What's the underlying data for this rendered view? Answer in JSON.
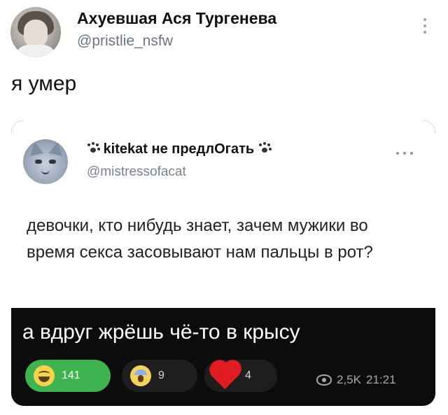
{
  "top_tweet": {
    "author_name": "Ахуевшая Ася Тургенева",
    "author_handle": "@pristlie_nsfw",
    "text": "я умер"
  },
  "quoted_post": {
    "author_name": "kitekat не предлОгать",
    "author_handle": "@mistressofacat",
    "text": "девочки, кто нибудь знает, зачем мужики во время секса засовывают нам пальцы в рот?"
  },
  "reply": {
    "text": "а вдруг жрёшь чё-то в крысу"
  },
  "reactions": [
    {
      "emoji": "grinning-face-icon",
      "count": "141",
      "selected": true
    },
    {
      "emoji": "screaming-face-icon",
      "count": "9",
      "selected": false
    },
    {
      "emoji": "red-heart-icon",
      "count": "4",
      "selected": false
    }
  ],
  "meta": {
    "views": "2,5K",
    "time": "21:21"
  },
  "colors": {
    "reaction_selected": "#3fb34f",
    "reply_background": "#0c0c0c"
  }
}
